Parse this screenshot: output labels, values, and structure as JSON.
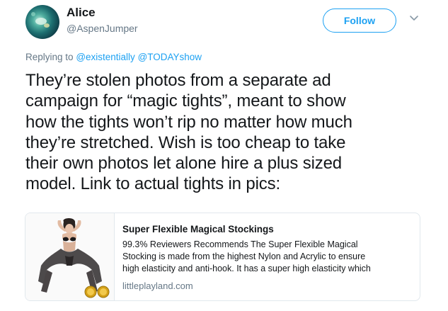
{
  "author": {
    "name": "Alice",
    "handle": "@AspenJumper"
  },
  "follow_label": "Follow",
  "reply": {
    "prefix": "Replying to",
    "mentions": [
      "@existentially",
      "@TODAYshow"
    ]
  },
  "tweet": {
    "lines": [
      "They’re stolen photos from a separate ad",
      "campaign for “magic tights”, meant to show",
      "how the tights won’t rip no matter how much",
      "they’re stretched. Wish is too cheap to take",
      "their own photos let alone hire a plus sized",
      "model. Link to actual tights in pics:"
    ]
  },
  "card": {
    "title": "Super Flexible Magical Stockings",
    "description_lines": [
      "99.3% Reviewers Recommends The Super Flexible Magical",
      "Stocking is made from the highest Nylon and Acrylic to ensure",
      "high elasticity and anti-hook. It has a super high elasticity which"
    ],
    "domain": "littleplayland.com"
  },
  "colors": {
    "accent": "#1da1f2",
    "text": "#14171a",
    "muted": "#657786",
    "border": "#e1e8ed"
  },
  "icons": {
    "caret": "chevron-down-icon",
    "badges": "gold-badge-icon"
  }
}
